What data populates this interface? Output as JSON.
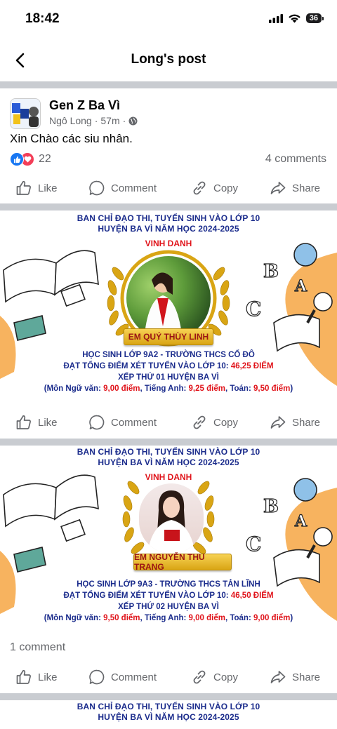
{
  "status": {
    "time": "18:42",
    "battery": "36"
  },
  "header": {
    "title": "Long's post"
  },
  "post": {
    "group_name": "Gen Z Ba Vì",
    "author": "Ngô Long",
    "time": "57m",
    "separator_dot": "·",
    "text": "Xin Chào các siu nhân.",
    "reaction_count": "22",
    "comments_count": "4 comments"
  },
  "actions": {
    "like": "Like",
    "comment": "Comment",
    "copy": "Copy",
    "share": "Share"
  },
  "card1": {
    "title_line1": "BAN CHỈ ĐẠO THI, TUYỂN SINH VÀO LỚP 10",
    "title_line2": "HUYỆN BA VÌ NĂM HỌC 2024-2025",
    "honor": "VINH DANH",
    "name": "EM QUÝ THÙY LINH",
    "line1": "HỌC SINH LỚP 9A2 - TRƯỜNG THCS CỔ ĐÔ",
    "line2_prefix": "ĐẠT TỔNG ĐIỂM XÉT TUYỂN VÀO LỚP 10: ",
    "line2_score": "46,25 ĐIỂM",
    "line3": "XẾP THỨ 01 HUYỆN BA VÌ",
    "line4_a": "(Môn Ngữ văn: ",
    "line4_b": "9,00 điểm",
    "line4_c": ", Tiếng Anh: ",
    "line4_d": "9,25 điểm",
    "line4_e": ", Toán: ",
    "line4_f": "9,50 điểm",
    "line4_g": ")"
  },
  "card2": {
    "title_line1": "BAN CHỈ ĐẠO THI, TUYỂN SINH VÀO LỚP 10",
    "title_line2": "HUYỆN BA VÌ NĂM HỌC 2024-2025",
    "honor": "VINH DANH",
    "name": "EM NGUYỄN THU TRANG",
    "line1": "HỌC SINH LỚP 9A3 - TRƯỜNG THCS TẢN LĨNH",
    "line2_prefix": "ĐẠT TỔNG ĐIỂM XÉT TUYỂN VÀO LỚP 10: ",
    "line2_score": "46,50 ĐIỂM",
    "line3": "XẾP THỨ 02 HUYỆN BA VÌ",
    "line4_a": "(Môn Ngữ văn: ",
    "line4_b": "9,50 điểm",
    "line4_c": ", Tiếng Anh: ",
    "line4_d": "9,00 điểm",
    "line4_e": ", Toán: ",
    "line4_f": "9,00 điểm",
    "line4_g": ")",
    "comment_count": "1 comment"
  },
  "card3": {
    "title_line1": "BAN CHỈ ĐẠO THI, TUYỂN SINH VÀO LỚP 10",
    "title_line2": "HUYỆN BA VÌ NĂM HỌC 2024-2025"
  },
  "colors": {
    "accent": "#1877f2",
    "love": "#f33e58",
    "title_blue": "#1b2c8c",
    "highlight_red": "#e0141b",
    "gold": "#d9a514",
    "orange_blob": "#f7b35f"
  },
  "icons": [
    "back-chevron-icon",
    "signal-icon",
    "wifi-icon",
    "globe-icon",
    "like-icon",
    "comment-icon",
    "copy-icon",
    "share-icon"
  ]
}
